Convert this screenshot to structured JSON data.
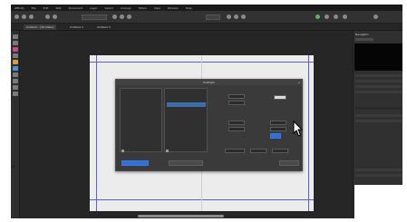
{
  "menubar": {
    "items": [
      "Affinity",
      "File",
      "Edit",
      "Text",
      "Document",
      "Layer",
      "Select",
      "Arrange",
      "Filters",
      "View",
      "Window",
      "Help"
    ]
  },
  "document_tabs": [
    "Untitled – [Modified]",
    "Untitled 2",
    "Untitled 3"
  ],
  "dialog": {
    "title": "Preflight",
    "close_glyph": "×",
    "left_list": {
      "header": "",
      "items": [
        "",
        ""
      ]
    },
    "middle_list": {
      "header": "",
      "items": [
        "",
        ""
      ]
    },
    "fields": {
      "field_a": "",
      "field_b": "",
      "field_c": "",
      "field_d": "",
      "field_e": "",
      "field_f": ""
    },
    "buttons": {
      "left_blue": "",
      "middle": "",
      "right": ""
    }
  },
  "right_panel": {
    "tab_label": "Navigator"
  },
  "colors": {
    "accent_blue": "#2f6fd6",
    "guide_blue": "#5a60c8",
    "selection_blue": "#3d6ea8",
    "toolbar_bg": "#323232",
    "canvas_bg": "#262626"
  },
  "icons": [
    "chevron-icon",
    "gear-icon",
    "search-icon",
    "close-icon",
    "mouse-pointer-icon"
  ]
}
